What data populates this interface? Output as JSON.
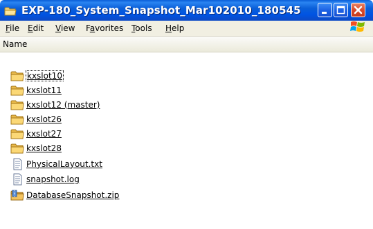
{
  "window": {
    "title": "EXP-180_System_Snapshot_Mar102010_180545"
  },
  "menu": {
    "items": [
      {
        "label": "File",
        "accel": "F",
        "rest": "ile"
      },
      {
        "label": "Edit",
        "accel": "E",
        "rest": "dit"
      },
      {
        "label": "View",
        "accel": "V",
        "rest": "iew"
      },
      {
        "label": "Favorites",
        "pre": "F",
        "accel": "a",
        "rest": "vorites"
      },
      {
        "label": "Tools",
        "accel": "T",
        "rest": "ools"
      },
      {
        "label": "Help",
        "accel": "H",
        "rest": "elp"
      }
    ]
  },
  "columns": {
    "name": "Name"
  },
  "files": [
    {
      "name": "kxslot10",
      "icon": "folder-icon"
    },
    {
      "name": "kxslot11",
      "icon": "folder-icon"
    },
    {
      "name": "kxslot12 (master)",
      "icon": "folder-icon"
    },
    {
      "name": "kxslot26",
      "icon": "folder-icon"
    },
    {
      "name": "kxslot27",
      "icon": "folder-icon"
    },
    {
      "name": "kxslot28",
      "icon": "folder-icon"
    },
    {
      "name": "PhysicalLayout.txt",
      "icon": "text-file-icon"
    },
    {
      "name": "snapshot.log",
      "icon": "text-file-icon"
    },
    {
      "name": "DatabaseSnapshot.zip",
      "icon": "zip-folder-icon"
    }
  ],
  "colors": {
    "titlebar": "#0054e3",
    "menubar": "#f1efe2",
    "close_button": "#d9492a"
  }
}
